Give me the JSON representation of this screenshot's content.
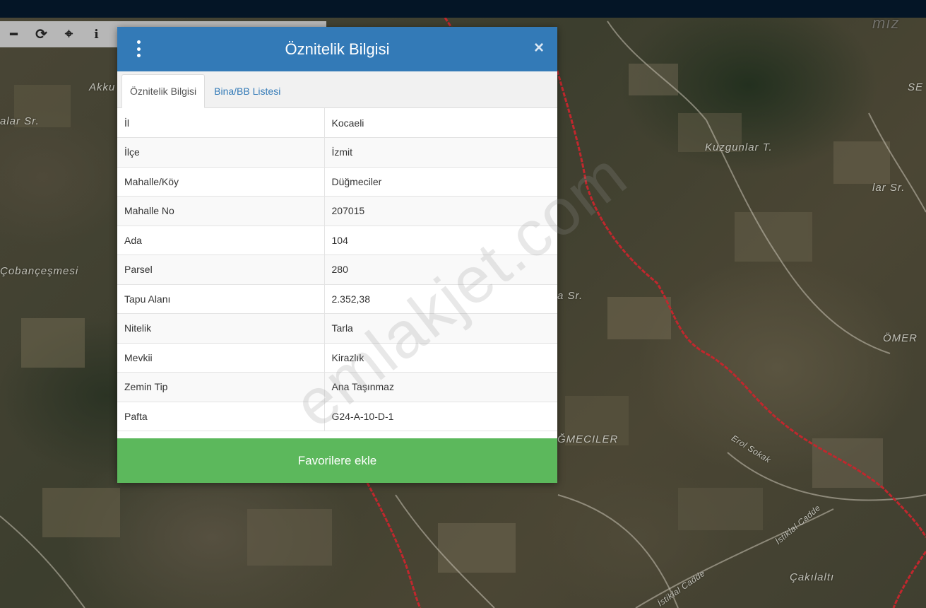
{
  "map": {
    "labels": [
      "Akku",
      "alar Sr.",
      "Çobançeşmesi",
      "Kuzgunlar T.",
      "lar Sr.",
      "SE",
      "ÖMER",
      "a Sr.",
      "ĞMECILER",
      "Erol Sokak",
      "İstiklal Cadde",
      "İstiklal Cadde",
      "Çakılaltı",
      "mız"
    ],
    "border_color": "#c1272d"
  },
  "toolbar": {
    "icons": [
      "minus-icon",
      "refresh-icon",
      "crosshair-icon",
      "info-icon"
    ],
    "glyphs": [
      "━",
      "⟳",
      "⌖",
      "i"
    ]
  },
  "modal": {
    "title": "Öznitelik Bilgisi",
    "close_glyph": "×",
    "tabs": [
      {
        "label": "Öznitelik Bilgisi",
        "active": true
      },
      {
        "label": "Bina/BB Listesi",
        "active": false
      }
    ],
    "rows": [
      {
        "key": "İl",
        "value": "Kocaeli"
      },
      {
        "key": "İlçe",
        "value": "İzmit"
      },
      {
        "key": "Mahalle/Köy",
        "value": "Düğmeciler"
      },
      {
        "key": "Mahalle No",
        "value": "207015"
      },
      {
        "key": "Ada",
        "value": "104"
      },
      {
        "key": "Parsel",
        "value": "280"
      },
      {
        "key": "Tapu Alanı",
        "value": "2.352,38"
      },
      {
        "key": "Nitelik",
        "value": "Tarla"
      },
      {
        "key": "Mevkii",
        "value": "Kirazlık"
      },
      {
        "key": "Zemin Tip",
        "value": "Ana Taşınmaz"
      },
      {
        "key": "Pafta",
        "value": "G24-A-10-D-1"
      }
    ],
    "favorite_button": "Favorilere ekle",
    "header_color": "#337ab7",
    "button_color": "#5cb85c"
  },
  "watermark": "emlakjet.com"
}
